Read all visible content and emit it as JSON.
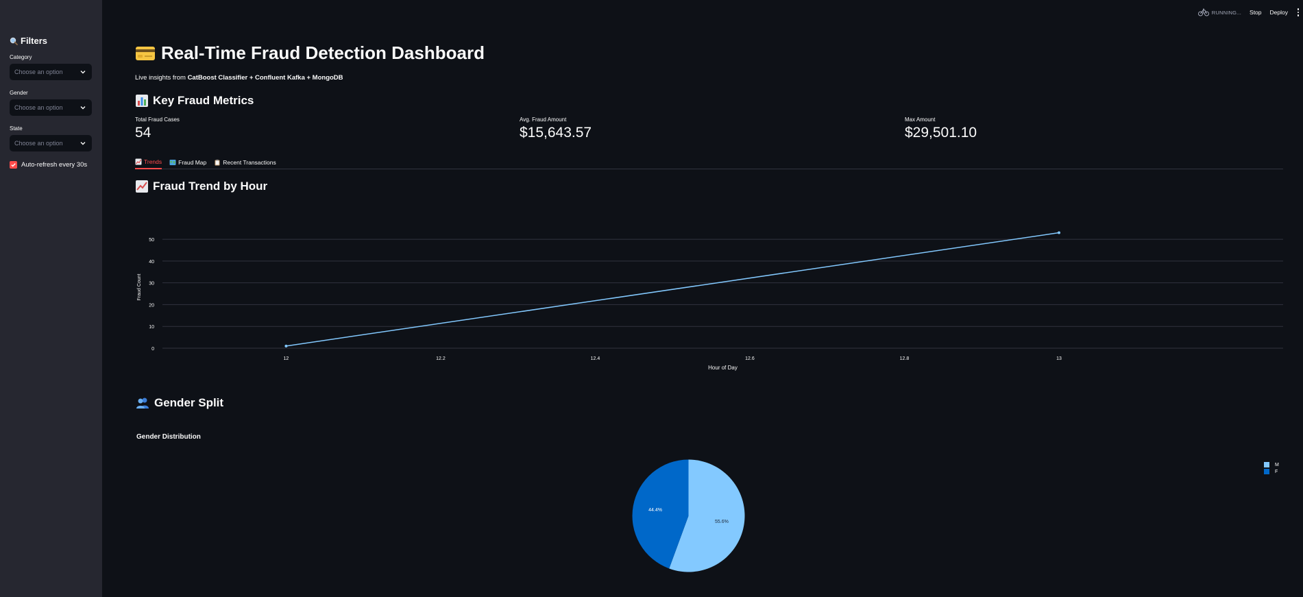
{
  "sidebar": {
    "title": "Filters",
    "filters": [
      {
        "label": "Category",
        "placeholder": "Choose an option"
      },
      {
        "label": "Gender",
        "placeholder": "Choose an option"
      },
      {
        "label": "State",
        "placeholder": "Choose an option"
      }
    ],
    "auto_refresh": {
      "label": "Auto-refresh every 30s",
      "checked": true
    }
  },
  "topbar": {
    "status": "RUNNING...",
    "stop": "Stop",
    "deploy": "Deploy"
  },
  "main": {
    "title": "Real-Time Fraud Detection Dashboard",
    "subtitle_prefix": "Live insights from ",
    "subtitle_bold": "CatBoost Classifier + Confluent Kafka + MongoDB",
    "metrics_heading": "Key Fraud Metrics",
    "metrics": [
      {
        "label": "Total Fraud Cases",
        "value": "54"
      },
      {
        "label": "Avg. Fraud Amount",
        "value": "$15,643.57"
      },
      {
        "label": "Max Amount",
        "value": "$29,501.10"
      }
    ],
    "tabs": [
      {
        "label": "Trends",
        "active": true
      },
      {
        "label": "Fraud Map",
        "active": false
      },
      {
        "label": "Recent Transactions",
        "active": false
      }
    ],
    "trend_heading": "Fraud Trend by Hour",
    "gender_heading": "Gender Split"
  },
  "colors": {
    "accent": "#ff4b4b",
    "line": "#83c9ff",
    "pie_m": "#83c9ff",
    "pie_f": "#0068c9"
  },
  "chart_data": [
    {
      "type": "line",
      "x": [
        12,
        13
      ],
      "y": [
        1,
        53
      ],
      "xlabel": "Hour of Day",
      "ylabel": "Fraud Count",
      "xticks": [
        "12",
        "12.2",
        "12.4",
        "12.6",
        "12.8",
        "13"
      ],
      "yticks": [
        "0",
        "10",
        "20",
        "30",
        "40",
        "50"
      ],
      "xlim": [
        11.84,
        13.29
      ],
      "ylim": [
        0,
        56
      ],
      "grid": true
    },
    {
      "type": "pie",
      "title": "Gender Distribution",
      "labels": [
        "M",
        "F"
      ],
      "values": [
        55.6,
        44.4
      ],
      "value_labels": [
        "55.6%",
        "44.4%"
      ],
      "legend_position": "top-right"
    }
  ]
}
